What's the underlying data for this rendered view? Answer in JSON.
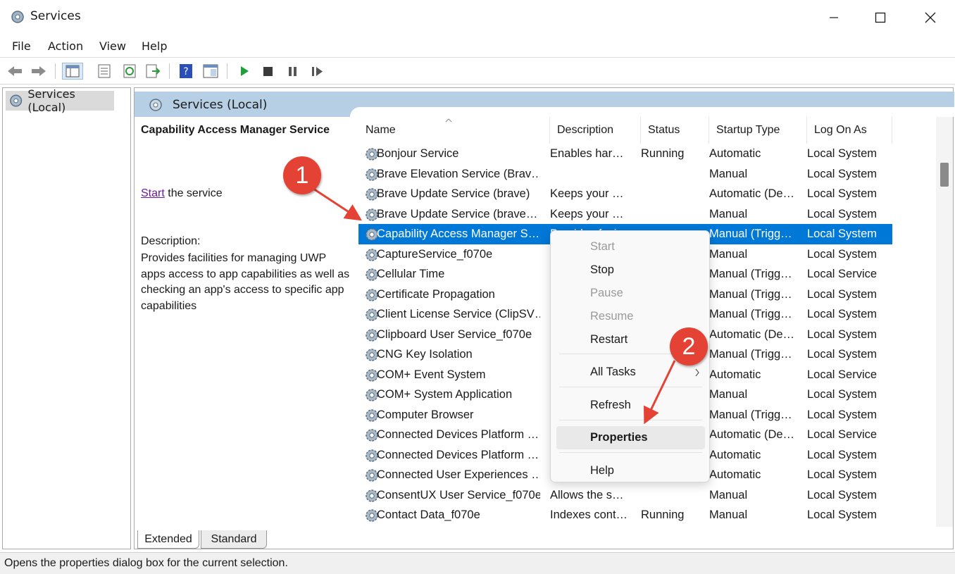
{
  "window": {
    "title": "Services"
  },
  "menu": [
    "File",
    "Action",
    "View",
    "Help"
  ],
  "tree": {
    "node": "Services (Local)"
  },
  "header": {
    "title": "Services (Local)"
  },
  "details": {
    "service_name": "Capability Access Manager Service",
    "start_link": "Start",
    "start_suffix": " the service",
    "description_label": "Description:",
    "description": "Provides facilities for managing UWP apps access to app capabilities as well as checking an app's access to specific app capabilities"
  },
  "columns": [
    "Name",
    "Description",
    "Status",
    "Startup Type",
    "Log On As"
  ],
  "rows": [
    {
      "name": "Bonjour Service",
      "desc": "Enables har…",
      "status": "Running",
      "startup": "Automatic",
      "logon": "Local System"
    },
    {
      "name": "Brave Elevation Service (Brav…",
      "desc": "",
      "status": "",
      "startup": "Manual",
      "logon": "Local System"
    },
    {
      "name": "Brave Update Service (brave)",
      "desc": "Keeps your …",
      "status": "",
      "startup": "Automatic (De…",
      "logon": "Local System"
    },
    {
      "name": "Brave Update Service (brave…",
      "desc": "Keeps your …",
      "status": "",
      "startup": "Manual",
      "logon": "Local System"
    },
    {
      "name": "Capability Access Manager S…",
      "desc": "Provides faci…",
      "status": "",
      "startup": "Manual (Trigg…",
      "logon": "Local System"
    },
    {
      "name": "CaptureService_f070e",
      "desc": "",
      "status": "",
      "startup": "Manual",
      "logon": "Local System"
    },
    {
      "name": "Cellular Time",
      "desc": "",
      "status": "",
      "startup": "Manual (Trigg…",
      "logon": "Local Service"
    },
    {
      "name": "Certificate Propagation",
      "desc": "",
      "status": "",
      "startup": "Manual (Trigg…",
      "logon": "Local System"
    },
    {
      "name": "Client License Service (ClipSV…",
      "desc": "",
      "status": "",
      "startup": "Manual (Trigg…",
      "logon": "Local System"
    },
    {
      "name": "Clipboard User Service_f070e",
      "desc": "",
      "status": "",
      "startup": "Automatic (De…",
      "logon": "Local System"
    },
    {
      "name": "CNG Key Isolation",
      "desc": "",
      "status": "",
      "startup": "Manual (Trigg…",
      "logon": "Local System"
    },
    {
      "name": "COM+ Event System",
      "desc": "",
      "status": "",
      "startup": "Automatic",
      "logon": "Local Service"
    },
    {
      "name": "COM+ System Application",
      "desc": "",
      "status": "",
      "startup": "Manual",
      "logon": "Local System"
    },
    {
      "name": "Computer Browser",
      "desc": "",
      "status": "",
      "startup": "Manual (Trigg…",
      "logon": "Local System"
    },
    {
      "name": "Connected Devices Platform …",
      "desc": "",
      "status": "",
      "startup": "Automatic (De…",
      "logon": "Local Service"
    },
    {
      "name": "Connected Devices Platform …",
      "desc": "",
      "status": "",
      "startup": "Automatic",
      "logon": "Local System"
    },
    {
      "name": "Connected User Experiences …",
      "desc": "",
      "status": "",
      "startup": "Automatic",
      "logon": "Local System"
    },
    {
      "name": "ConsentUX User Service_f070e",
      "desc": "Allows the s…",
      "status": "",
      "startup": "Manual",
      "logon": "Local System"
    },
    {
      "name": "Contact Data_f070e",
      "desc": "Indexes cont…",
      "status": "Running",
      "startup": "Manual",
      "logon": "Local System"
    }
  ],
  "context_menu": {
    "start": "Start",
    "stop": "Stop",
    "pause": "Pause",
    "resume": "Resume",
    "restart": "Restart",
    "all_tasks": "All Tasks",
    "refresh": "Refresh",
    "properties": "Properties",
    "help": "Help"
  },
  "tabs": [
    "Extended",
    "Standard"
  ],
  "status_bar": "Opens the properties dialog box for the current selection.",
  "annotations": [
    "1",
    "2"
  ],
  "colors": {
    "selection": "#0078d7",
    "header": "#b7cfe5",
    "badge": "#e34235",
    "play": "#1f9e3a"
  }
}
